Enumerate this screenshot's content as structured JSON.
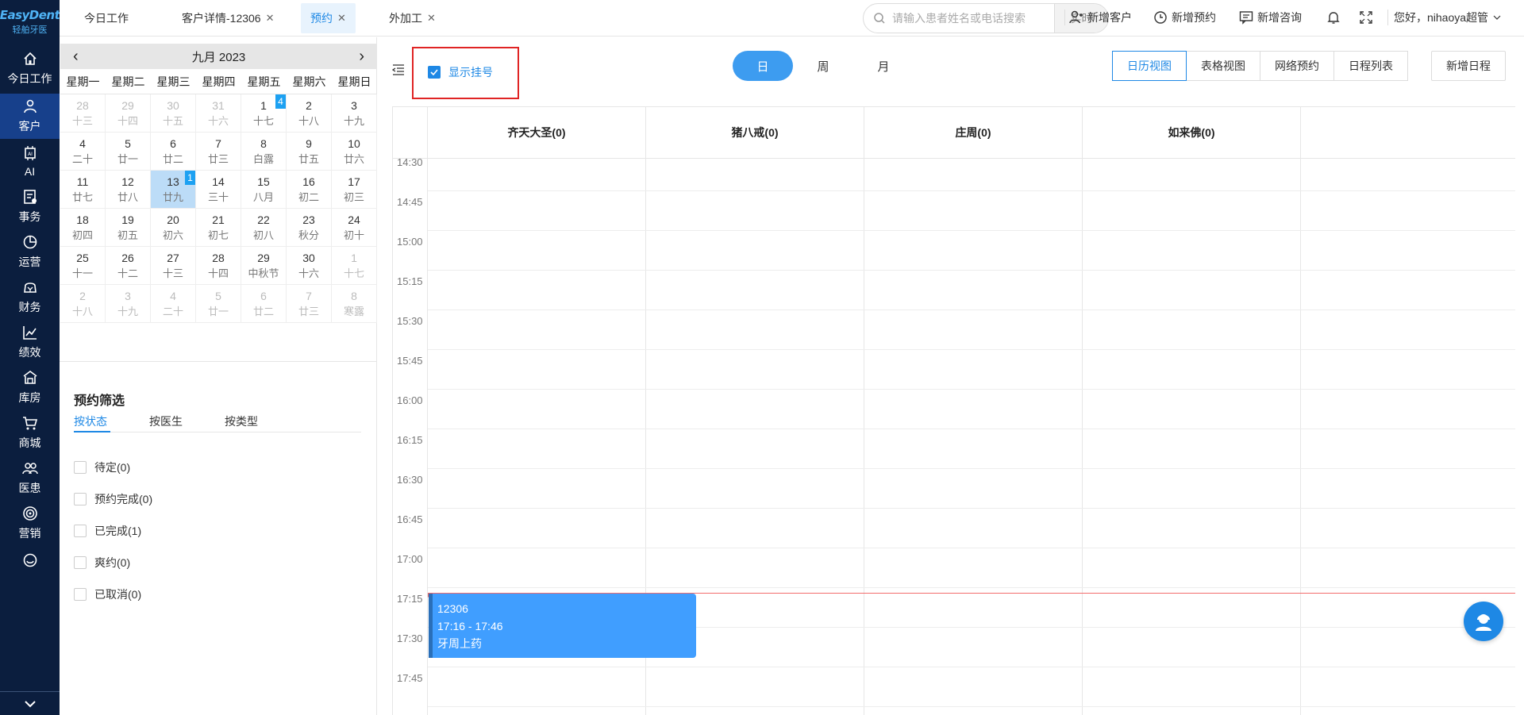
{
  "logo": {
    "brand": "EasyDent",
    "subtitle": "轻舶牙医"
  },
  "nav": {
    "items": [
      {
        "label": "今日工作",
        "icon": "home-icon"
      },
      {
        "label": "客户",
        "icon": "user-icon"
      },
      {
        "label": "AI",
        "icon": "ai-chip-icon"
      },
      {
        "label": "事务",
        "icon": "task-icon"
      },
      {
        "label": "运营",
        "icon": "pie-chart-icon"
      },
      {
        "label": "财务",
        "icon": "money-icon"
      },
      {
        "label": "绩效",
        "icon": "trend-icon"
      },
      {
        "label": "库房",
        "icon": "warehouse-icon"
      },
      {
        "label": "商城",
        "icon": "cart-icon"
      },
      {
        "label": "医患",
        "icon": "doctor-patient-icon"
      },
      {
        "label": "营销",
        "icon": "target-icon"
      }
    ]
  },
  "tabs": [
    {
      "label": "今日工作",
      "closable": false
    },
    {
      "label": "客户详情-12306",
      "closable": true
    },
    {
      "label": "预约",
      "closable": true
    },
    {
      "label": "外加工",
      "closable": true
    }
  ],
  "search": {
    "placeholder": "请输入患者姓名或电话搜索",
    "realtime": "实时"
  },
  "actions": {
    "new_customer": "新增客户",
    "new_appointment": "新增预约",
    "new_consult": "新增咨询",
    "greeting": "您好，nihaoya超管"
  },
  "calendar": {
    "month_title": "九月 2023",
    "weekdays": [
      "星期一",
      "星期二",
      "星期三",
      "星期四",
      "星期五",
      "星期六",
      "星期日"
    ],
    "days": [
      {
        "n": "28",
        "l": "十三",
        "o": true
      },
      {
        "n": "29",
        "l": "十四",
        "o": true
      },
      {
        "n": "30",
        "l": "十五",
        "o": true
      },
      {
        "n": "31",
        "l": "十六",
        "o": true
      },
      {
        "n": "1",
        "l": "十七",
        "b": "4"
      },
      {
        "n": "2",
        "l": "十八"
      },
      {
        "n": "3",
        "l": "十九"
      },
      {
        "n": "4",
        "l": "二十"
      },
      {
        "n": "5",
        "l": "廿一"
      },
      {
        "n": "6",
        "l": "廿二"
      },
      {
        "n": "7",
        "l": "廿三"
      },
      {
        "n": "8",
        "l": "白露"
      },
      {
        "n": "9",
        "l": "廿五"
      },
      {
        "n": "10",
        "l": "廿六"
      },
      {
        "n": "11",
        "l": "廿七"
      },
      {
        "n": "12",
        "l": "廿八"
      },
      {
        "n": "13",
        "l": "廿九",
        "s": true,
        "b": "1"
      },
      {
        "n": "14",
        "l": "三十"
      },
      {
        "n": "15",
        "l": "八月"
      },
      {
        "n": "16",
        "l": "初二"
      },
      {
        "n": "17",
        "l": "初三"
      },
      {
        "n": "18",
        "l": "初四"
      },
      {
        "n": "19",
        "l": "初五"
      },
      {
        "n": "20",
        "l": "初六"
      },
      {
        "n": "21",
        "l": "初七"
      },
      {
        "n": "22",
        "l": "初八"
      },
      {
        "n": "23",
        "l": "秋分"
      },
      {
        "n": "24",
        "l": "初十"
      },
      {
        "n": "25",
        "l": "十一"
      },
      {
        "n": "26",
        "l": "十二"
      },
      {
        "n": "27",
        "l": "十三"
      },
      {
        "n": "28",
        "l": "十四"
      },
      {
        "n": "29",
        "l": "中秋节"
      },
      {
        "n": "30",
        "l": "十六"
      },
      {
        "n": "1",
        "l": "十七",
        "o": true
      },
      {
        "n": "2",
        "l": "十八",
        "o": true
      },
      {
        "n": "3",
        "l": "十九",
        "o": true
      },
      {
        "n": "4",
        "l": "二十",
        "o": true
      },
      {
        "n": "5",
        "l": "廿一",
        "o": true
      },
      {
        "n": "6",
        "l": "廿二",
        "o": true
      },
      {
        "n": "7",
        "l": "廿三",
        "o": true
      },
      {
        "n": "8",
        "l": "寒露",
        "o": true
      }
    ]
  },
  "filter": {
    "title": "预约筛选",
    "tabs": [
      "按状态",
      "按医生",
      "按类型"
    ],
    "options": [
      "待定(0)",
      "预约完成(0)",
      "已完成(1)",
      "爽约(0)",
      "已取消(0)"
    ]
  },
  "toolbar": {
    "show_registration": "显示挂号",
    "range_buttons": [
      "日",
      "周",
      "月"
    ],
    "views": [
      "日历视图",
      "表格视图",
      "网络预约",
      "日程列表"
    ],
    "new_schedule": "新增日程"
  },
  "schedule": {
    "doctors": [
      "齐天大圣(0)",
      "猪八戒(0)",
      "庄周(0)",
      "如来佛(0)"
    ],
    "times": [
      "14:30",
      "14:45",
      "15:00",
      "15:15",
      "15:30",
      "15:45",
      "16:00",
      "16:15",
      "16:30",
      "16:45",
      "17:00",
      "17:15",
      "17:30",
      "17:45"
    ],
    "appointment": {
      "patient": "12306",
      "time": "17:16 - 17:46",
      "item": "牙周上药"
    }
  },
  "colors": {
    "accent": "#1e88e5",
    "nav_bg": "#0b1e3e",
    "appointment": "#409eff",
    "now_line": "#f26b6b"
  }
}
